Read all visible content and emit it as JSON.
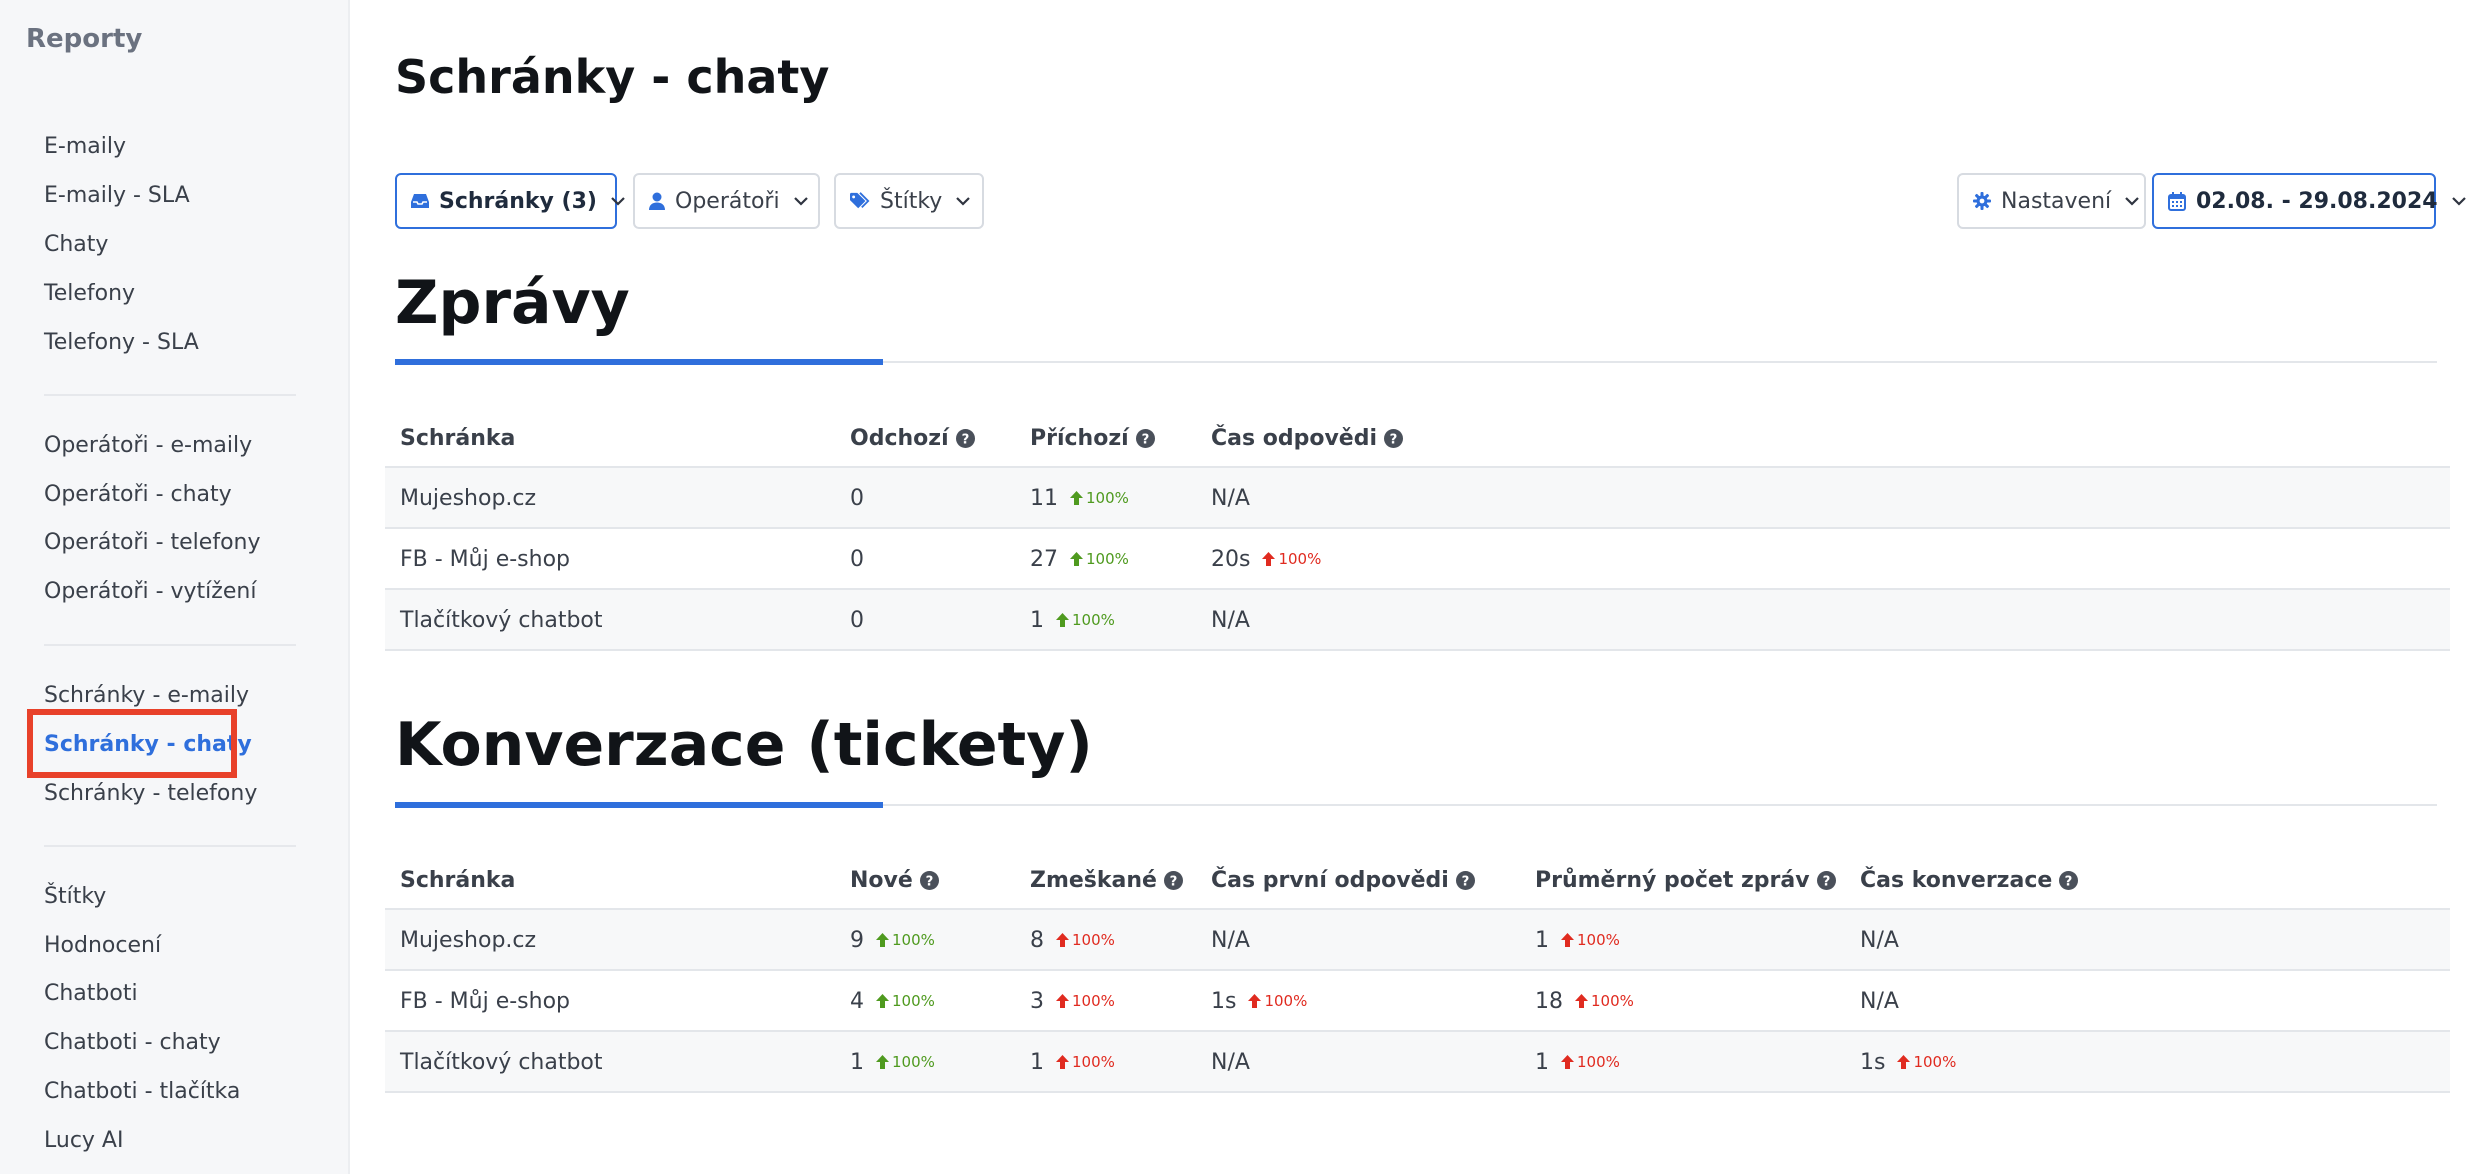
{
  "sidebar": {
    "title": "Reporty",
    "groups": [
      [
        {
          "label": "E-maily"
        },
        {
          "label": "E-maily - SLA"
        },
        {
          "label": "Chaty"
        },
        {
          "label": "Telefony"
        },
        {
          "label": "Telefony - SLA"
        }
      ],
      [
        {
          "label": "Operátoři - e-maily"
        },
        {
          "label": "Operátoři - chaty"
        },
        {
          "label": "Operátoři - telefony"
        },
        {
          "label": "Operátoři - vytížení"
        }
      ],
      [
        {
          "label": "Schránky - e-maily"
        },
        {
          "label": "Schránky - chaty",
          "active": true
        },
        {
          "label": "Schránky - telefony"
        }
      ],
      [
        {
          "label": "Štítky"
        },
        {
          "label": "Hodnocení"
        },
        {
          "label": "Chatboti"
        },
        {
          "label": "Chatboti - chaty"
        },
        {
          "label": "Chatboti - tlačítka"
        },
        {
          "label": "Lucy AI"
        }
      ]
    ]
  },
  "page": {
    "title": "Schránky - chaty"
  },
  "filters": {
    "inboxes": {
      "label": "Schránky (3)",
      "icon": "inbox-icon"
    },
    "operators": {
      "label": "Operátoři",
      "icon": "user-icon"
    },
    "tags": {
      "label": "Štítky",
      "icon": "tags-icon"
    },
    "settings": {
      "label": "Nastavení",
      "icon": "gear-icon"
    },
    "daterange": {
      "label": "02.08. - 29.08.2024",
      "icon": "calendar-icon"
    }
  },
  "colors": {
    "accent": "#2f6fdc",
    "trend_green": "#4f9a1f",
    "trend_red": "#e02b20",
    "highlight": "#e8412a"
  },
  "messages": {
    "title": "Zprávy",
    "headers": {
      "inbox": "Schránka",
      "outgoing": "Odchozí",
      "incoming": "Příchozí",
      "response": "Čas odpovědi"
    },
    "rows": [
      {
        "inbox": "Mujeshop.cz",
        "outgoing": "0",
        "incoming": "11",
        "incoming_trend": "100%",
        "response": "N/A",
        "response_trend": ""
      },
      {
        "inbox": "FB - Můj e-shop",
        "outgoing": "0",
        "incoming": "27",
        "incoming_trend": "100%",
        "response": "20s",
        "response_trend": "100%"
      },
      {
        "inbox": "Tlačítkový chatbot",
        "outgoing": "0",
        "incoming": "1",
        "incoming_trend": "100%",
        "response": "N/A",
        "response_trend": ""
      }
    ]
  },
  "conversations": {
    "title": "Konverzace (tickety)",
    "headers": {
      "inbox": "Schránka",
      "new": "Nové",
      "missed": "Zmeškané",
      "first_response": "Čas první odpovědi",
      "avg_messages": "Průměrný počet zpráv",
      "duration": "Čas konverzace"
    },
    "rows": [
      {
        "inbox": "Mujeshop.cz",
        "new": "9",
        "new_trend": "100%",
        "missed": "8",
        "missed_trend": "100%",
        "first_response": "N/A",
        "first_response_trend": "",
        "avg_messages": "1",
        "avg_messages_trend": "100%",
        "duration": "N/A",
        "duration_trend": ""
      },
      {
        "inbox": "FB - Můj e-shop",
        "new": "4",
        "new_trend": "100%",
        "missed": "3",
        "missed_trend": "100%",
        "first_response": "1s",
        "first_response_trend": "100%",
        "avg_messages": "18",
        "avg_messages_trend": "100%",
        "duration": "N/A",
        "duration_trend": ""
      },
      {
        "inbox": "Tlačítkový chatbot",
        "new": "1",
        "new_trend": "100%",
        "missed": "1",
        "missed_trend": "100%",
        "first_response": "N/A",
        "first_response_trend": "",
        "avg_messages": "1",
        "avg_messages_trend": "100%",
        "duration": "1s",
        "duration_trend": "100%"
      }
    ]
  }
}
